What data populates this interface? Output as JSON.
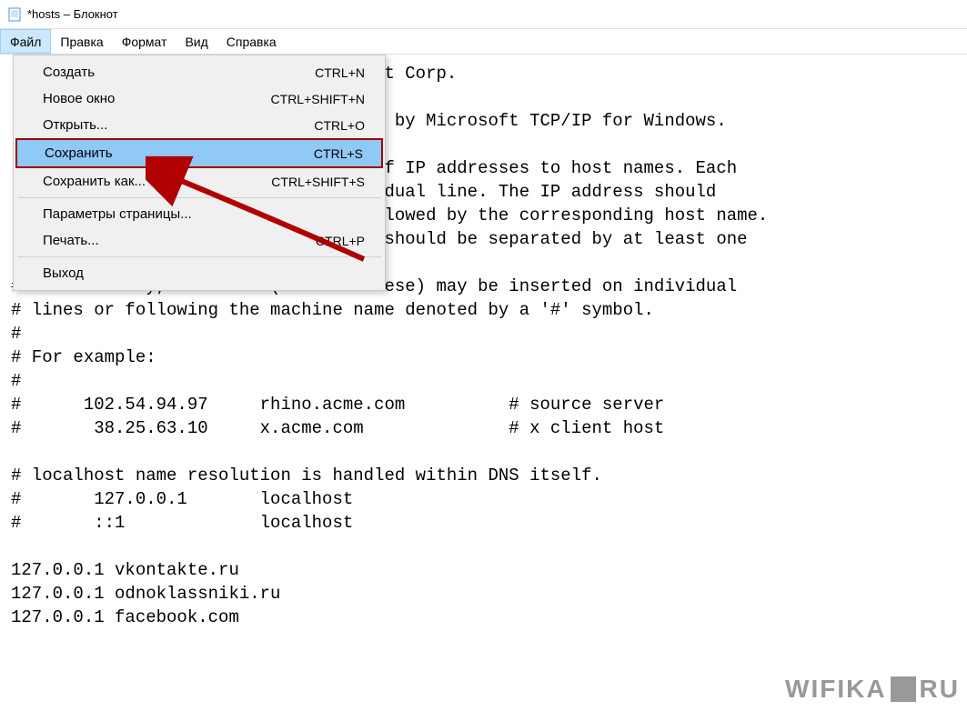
{
  "titlebar": {
    "title": "*hosts – Блокнот"
  },
  "menubar": {
    "items": [
      {
        "label": "Файл"
      },
      {
        "label": "Правка"
      },
      {
        "label": "Формат"
      },
      {
        "label": "Вид"
      },
      {
        "label": "Справка"
      }
    ]
  },
  "dropdown": {
    "items": [
      {
        "label": "Создать",
        "shortcut": "CTRL+N"
      },
      {
        "label": "Новое окно",
        "shortcut": "CTRL+SHIFT+N"
      },
      {
        "label": "Открыть...",
        "shortcut": "CTRL+O"
      },
      {
        "label": "Сохранить",
        "shortcut": "CTRL+S",
        "highlighted": true
      },
      {
        "label": "Сохранить как...",
        "shortcut": "CTRL+SHIFT+S"
      },
      {
        "label": "Параметры страницы...",
        "shortcut": ""
      },
      {
        "label": "Печать...",
        "shortcut": "CTRL+P"
      },
      {
        "label": "Выход",
        "shortcut": ""
      }
    ]
  },
  "editor": {
    "content": "                                    t Corp.\n\n                                     by Microsoft TCP/IP for Windows.\n\n                                    f IP addresses to host names. Each\n                                    dual line. The IP address should\n                                    lowed by the corresponding host name.\n                                    should be separated by at least one\n\n# Additionally, comments (such as these) may be inserted on individual\n# lines or following the machine name denoted by a '#' symbol.\n#\n# For example:\n#\n#      102.54.94.97     rhino.acme.com          # source server\n#       38.25.63.10     x.acme.com              # x client host\n\n# localhost name resolution is handled within DNS itself.\n#       127.0.0.1       localhost\n#       ::1             localhost\n\n127.0.0.1 vkontakte.ru\n127.0.0.1 odnoklassniki.ru\n127.0.0.1 facebook.com"
  },
  "watermark": {
    "text": "WIFIKA.RU"
  }
}
